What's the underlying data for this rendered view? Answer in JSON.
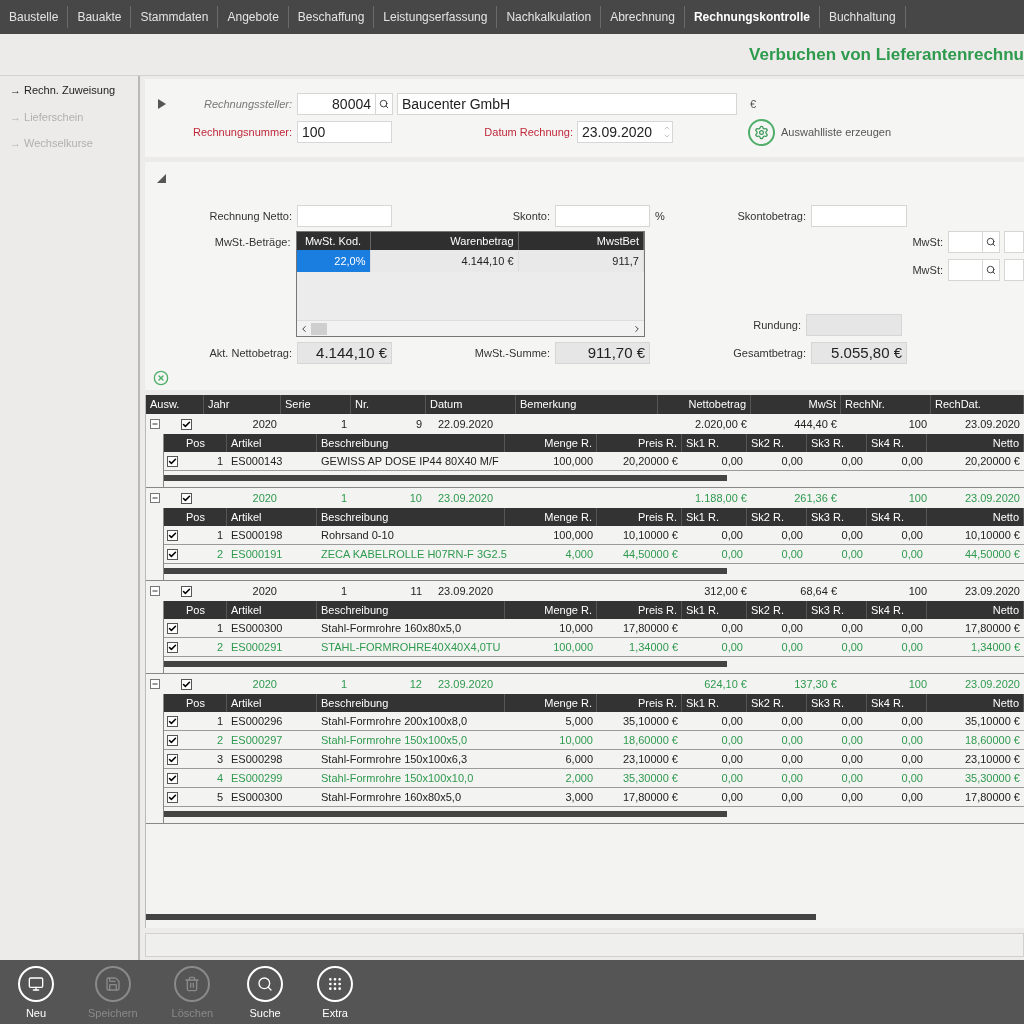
{
  "tabs": [
    {
      "label": "Baustelle",
      "selected": false
    },
    {
      "label": "Bauakte",
      "selected": false
    },
    {
      "label": "Stammdaten",
      "selected": false
    },
    {
      "label": "Angebote",
      "selected": false
    },
    {
      "label": "Beschaffung",
      "selected": false
    },
    {
      "label": "Leistungserfassung",
      "selected": false
    },
    {
      "label": "Nachkalkulation",
      "selected": false
    },
    {
      "label": "Abrechnung",
      "selected": false
    },
    {
      "label": "Rechnungskontrolle",
      "selected": true
    },
    {
      "label": "Buchhaltung",
      "selected": false
    }
  ],
  "page_title": "Verbuchen von Lieferantenrechnu",
  "sidebar": {
    "items": [
      {
        "label": "→ Rechn. Zuweisung",
        "disabled": false
      },
      {
        "label": "→ Lieferschein",
        "disabled": true
      },
      {
        "label": "→ Wechselkurse",
        "disabled": true
      }
    ]
  },
  "header": {
    "issuer_label": "Rechnungssteller:",
    "issuer_number": "80004",
    "issuer_name": "Baucenter GmbH",
    "currency": "€",
    "invoice_number_label": "Rechnungsnummer:",
    "invoice_number": "100",
    "date_label": "Datum Rechnung:",
    "date": "23.09.2020",
    "generate_button": "Auswahlliste erzeugen"
  },
  "summary": {
    "net_label": "Rechnung Netto:",
    "discount_label": "Skonto:",
    "percent": "%",
    "discount_amount_label": "Skontobetrag:",
    "vat_amounts_label": "MwSt.-Beträge:",
    "vat_table": {
      "columns": [
        "MwSt. Kod.",
        "Warenbetrag",
        "MwstBet"
      ],
      "rows": [
        {
          "cells": [
            "22,0%",
            "4.144,10 €",
            "911,7"
          ],
          "selected": true
        }
      ]
    },
    "vat_fields": [
      "MwSt:",
      "MwSt:"
    ],
    "rounding_label": "Rundung:",
    "net_total_label": "Akt. Nettobetrag:",
    "net_total": "4.144,10 €",
    "vat_sum_label": "MwSt.-Summe:",
    "vat_sum": "911,70 €",
    "gross_label": "Gesamtbetrag:",
    "gross": "5.055,80 €"
  },
  "grid": {
    "columns": [
      "Ausw.",
      "Jahr",
      "Serie",
      "Nr.",
      "Datum",
      "Bemerkung",
      "Nettobetrag",
      "MwSt",
      "RechNr.",
      "RechDat."
    ],
    "invoices": [
      {
        "expanded": true,
        "checked": true,
        "highlighted": false,
        "cells": [
          "2020",
          "1",
          "9",
          "22.09.2020",
          "",
          "2.020,00 €",
          "444,40 €",
          "100",
          "23.09.2020"
        ],
        "columns": [
          "Pos",
          "Artikel",
          "Beschreibung",
          "Menge R.",
          "Preis R.",
          "Sk1 R.",
          "Sk2 R.",
          "Sk3 R.",
          "Sk4 R.",
          "Netto"
        ],
        "items": [
          {
            "checked": true,
            "highlighted": false,
            "cells": [
              "1",
              "ES000143",
              "GEWISS AP DOSE IP44 80X40 M/F",
              "100,000",
              "20,20000 €",
              "0,00",
              "0,00",
              "0,00",
              "0,00",
              "20,20000 €"
            ]
          }
        ]
      },
      {
        "expanded": true,
        "checked": true,
        "highlighted": true,
        "cells": [
          "2020",
          "1",
          "10",
          "23.09.2020",
          "",
          "1.188,00 €",
          "261,36 €",
          "100",
          "23.09.2020"
        ],
        "columns": [
          "Pos",
          "Artikel",
          "Beschreibung",
          "Menge R.",
          "Preis R.",
          "Sk1 R.",
          "Sk2 R.",
          "Sk3 R.",
          "Sk4 R.",
          "Netto"
        ],
        "items": [
          {
            "checked": true,
            "highlighted": false,
            "cells": [
              "1",
              "ES000198",
              "Rohrsand 0-10",
              "100,000",
              "10,10000 €",
              "0,00",
              "0,00",
              "0,00",
              "0,00",
              "10,10000 €"
            ]
          },
          {
            "checked": true,
            "highlighted": true,
            "cells": [
              "2",
              "ES000191",
              "ZECA KABELROLLE H07RN-F 3G2.5",
              "4,000",
              "44,50000 €",
              "0,00",
              "0,00",
              "0,00",
              "0,00",
              "44,50000 €"
            ]
          }
        ]
      },
      {
        "expanded": true,
        "checked": true,
        "highlighted": false,
        "cells": [
          "2020",
          "1",
          "11",
          "23.09.2020",
          "",
          "312,00 €",
          "68,64 €",
          "100",
          "23.09.2020"
        ],
        "columns": [
          "Pos",
          "Artikel",
          "Beschreibung",
          "Menge R.",
          "Preis R.",
          "Sk1 R.",
          "Sk2 R.",
          "Sk3 R.",
          "Sk4 R.",
          "Netto"
        ],
        "items": [
          {
            "checked": true,
            "highlighted": false,
            "cells": [
              "1",
              "ES000300",
              "Stahl-Formrohre 160x80x5,0",
              "10,000",
              "17,80000 €",
              "0,00",
              "0,00",
              "0,00",
              "0,00",
              "17,80000 €"
            ]
          },
          {
            "checked": true,
            "highlighted": true,
            "cells": [
              "2",
              "ES000291",
              "STAHL-FORMROHRE40X40X4,0TU",
              "100,000",
              "1,34000 €",
              "0,00",
              "0,00",
              "0,00",
              "0,00",
              "1,34000 €"
            ]
          }
        ]
      },
      {
        "expanded": true,
        "checked": true,
        "highlighted": true,
        "cells": [
          "2020",
          "1",
          "12",
          "23.09.2020",
          "",
          "624,10 €",
          "137,30 €",
          "100",
          "23.09.2020"
        ],
        "columns": [
          "Pos",
          "Artikel",
          "Beschreibung",
          "Menge R.",
          "Preis R.",
          "Sk1 R.",
          "Sk2 R.",
          "Sk3 R.",
          "Sk4 R.",
          "Netto"
        ],
        "items": [
          {
            "checked": true,
            "highlighted": false,
            "cells": [
              "1",
              "ES000296",
              "Stahl-Formrohre 200x100x8,0",
              "5,000",
              "35,10000 €",
              "0,00",
              "0,00",
              "0,00",
              "0,00",
              "35,10000 €"
            ]
          },
          {
            "checked": true,
            "highlighted": true,
            "cells": [
              "2",
              "ES000297",
              "Stahl-Formrohre 150x100x5,0",
              "10,000",
              "18,60000 €",
              "0,00",
              "0,00",
              "0,00",
              "0,00",
              "18,60000 €"
            ]
          },
          {
            "checked": true,
            "highlighted": false,
            "cells": [
              "3",
              "ES000298",
              "Stahl-Formrohre 150x100x6,3",
              "6,000",
              "23,10000 €",
              "0,00",
              "0,00",
              "0,00",
              "0,00",
              "23,10000 €"
            ]
          },
          {
            "checked": true,
            "highlighted": true,
            "cells": [
              "4",
              "ES000299",
              "Stahl-Formrohre 150x100x10,0",
              "2,000",
              "35,30000 €",
              "0,00",
              "0,00",
              "0,00",
              "0,00",
              "35,30000 €"
            ]
          },
          {
            "checked": true,
            "highlighted": false,
            "cells": [
              "5",
              "ES000300",
              "Stahl-Formrohre 160x80x5,0",
              "3,000",
              "17,80000 €",
              "0,00",
              "0,00",
              "0,00",
              "0,00",
              "17,80000 €"
            ]
          }
        ]
      }
    ]
  },
  "toolbar": [
    {
      "kind": "new",
      "label": "Neu",
      "disabled": false
    },
    {
      "kind": "save",
      "label": "Speichern",
      "disabled": true
    },
    {
      "kind": "delete",
      "label": "Löschen",
      "disabled": true
    },
    {
      "kind": "search",
      "label": "Suche",
      "disabled": false
    },
    {
      "kind": "extra",
      "label": "Extra",
      "disabled": false
    }
  ]
}
